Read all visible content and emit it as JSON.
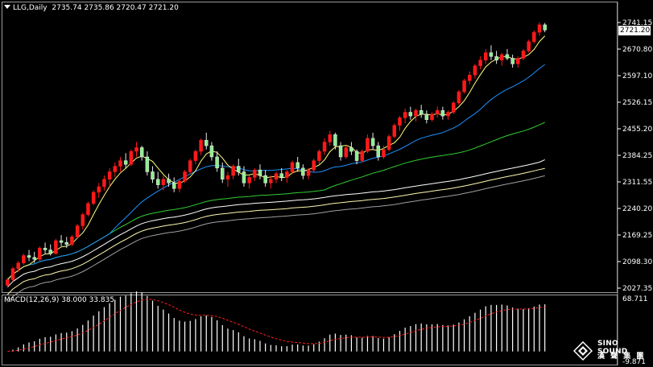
{
  "header": {
    "symbol": "LLG,Daily",
    "ohlc": "2735.74 2735.86 2720.47 2721.20",
    "indicator": "MACD(12,26,9) 38.000 33.835"
  },
  "price_axis": {
    "ticks": [
      "2741.15",
      "2670.80",
      "2597.10",
      "2526.15",
      "2455.20",
      "2384.25",
      "2311.55",
      "2240.20",
      "2169.25",
      "2098.30",
      "2027.35"
    ],
    "current": "2721.20"
  },
  "macd_axis": {
    "top": "68.711",
    "bottom": "-9.871"
  },
  "watermark": {
    "brand": "SINO SOUND",
    "sub": "漢 聲 集 團"
  },
  "colors": {
    "bull": "#ff1a1a",
    "bear": "#e8e8e8",
    "bear_fill": "#90ee90",
    "ma5": "#ffff80",
    "ma20": "#1e90ff",
    "ma60": "#32cd32",
    "ma100": "#ffffff",
    "ma200": "#fff8b0",
    "ma300": "#a0a0a0",
    "macd_hist": "#ffffff",
    "macd_signal": "#ff2020"
  },
  "chart_data": {
    "type": "candlestick",
    "timeframe": "Daily",
    "ylim": [
      2027.35,
      2741.15
    ],
    "candles": [
      [
        2035,
        2055,
        2030,
        2050
      ],
      [
        2050,
        2085,
        2045,
        2080
      ],
      [
        2080,
        2100,
        2070,
        2095
      ],
      [
        2095,
        2120,
        2090,
        2115
      ],
      [
        2115,
        2130,
        2100,
        2110
      ],
      [
        2110,
        2125,
        2095,
        2105
      ],
      [
        2105,
        2140,
        2100,
        2135
      ],
      [
        2135,
        2150,
        2120,
        2130
      ],
      [
        2130,
        2145,
        2115,
        2120
      ],
      [
        2120,
        2160,
        2118,
        2155
      ],
      [
        2155,
        2170,
        2140,
        2150
      ],
      [
        2150,
        2165,
        2135,
        2145
      ],
      [
        2145,
        2170,
        2140,
        2165
      ],
      [
        2165,
        2200,
        2160,
        2195
      ],
      [
        2195,
        2230,
        2185,
        2225
      ],
      [
        2225,
        2260,
        2220,
        2255
      ],
      [
        2255,
        2290,
        2250,
        2285
      ],
      [
        2285,
        2310,
        2270,
        2300
      ],
      [
        2300,
        2330,
        2290,
        2320
      ],
      [
        2320,
        2350,
        2300,
        2340
      ],
      [
        2340,
        2365,
        2325,
        2355
      ],
      [
        2355,
        2380,
        2340,
        2370
      ],
      [
        2370,
        2390,
        2350,
        2360
      ],
      [
        2360,
        2400,
        2355,
        2395
      ],
      [
        2395,
        2420,
        2380,
        2405
      ],
      [
        2405,
        2410,
        2370,
        2380
      ],
      [
        2380,
        2395,
        2330,
        2340
      ],
      [
        2340,
        2355,
        2310,
        2320
      ],
      [
        2320,
        2340,
        2295,
        2305
      ],
      [
        2305,
        2330,
        2290,
        2320
      ],
      [
        2320,
        2335,
        2300,
        2310
      ],
      [
        2310,
        2325,
        2285,
        2295
      ],
      [
        2295,
        2320,
        2285,
        2315
      ],
      [
        2315,
        2345,
        2310,
        2340
      ],
      [
        2340,
        2375,
        2335,
        2370
      ],
      [
        2370,
        2400,
        2360,
        2395
      ],
      [
        2395,
        2430,
        2385,
        2425
      ],
      [
        2425,
        2445,
        2400,
        2410
      ],
      [
        2410,
        2420,
        2370,
        2380
      ],
      [
        2380,
        2395,
        2340,
        2350
      ],
      [
        2350,
        2365,
        2310,
        2320
      ],
      [
        2320,
        2340,
        2300,
        2330
      ],
      [
        2330,
        2360,
        2320,
        2355
      ],
      [
        2355,
        2375,
        2330,
        2340
      ],
      [
        2340,
        2355,
        2300,
        2310
      ],
      [
        2310,
        2330,
        2295,
        2325
      ],
      [
        2325,
        2350,
        2315,
        2345
      ],
      [
        2345,
        2360,
        2320,
        2330
      ],
      [
        2330,
        2345,
        2300,
        2310
      ],
      [
        2310,
        2330,
        2295,
        2320
      ],
      [
        2320,
        2340,
        2310,
        2335
      ],
      [
        2335,
        2350,
        2315,
        2325
      ],
      [
        2325,
        2345,
        2310,
        2340
      ],
      [
        2340,
        2370,
        2335,
        2365
      ],
      [
        2365,
        2380,
        2340,
        2350
      ],
      [
        2350,
        2360,
        2320,
        2330
      ],
      [
        2330,
        2350,
        2320,
        2345
      ],
      [
        2345,
        2375,
        2340,
        2370
      ],
      [
        2370,
        2400,
        2360,
        2395
      ],
      [
        2395,
        2430,
        2385,
        2420
      ],
      [
        2420,
        2450,
        2410,
        2440
      ],
      [
        2440,
        2445,
        2400,
        2410
      ],
      [
        2410,
        2420,
        2370,
        2380
      ],
      [
        2380,
        2410,
        2375,
        2405
      ],
      [
        2405,
        2420,
        2385,
        2395
      ],
      [
        2395,
        2400,
        2360,
        2370
      ],
      [
        2370,
        2400,
        2365,
        2395
      ],
      [
        2395,
        2440,
        2390,
        2430
      ],
      [
        2430,
        2445,
        2400,
        2410
      ],
      [
        2410,
        2420,
        2370,
        2380
      ],
      [
        2380,
        2410,
        2375,
        2400
      ],
      [
        2400,
        2440,
        2395,
        2435
      ],
      [
        2435,
        2470,
        2430,
        2465
      ],
      [
        2465,
        2490,
        2450,
        2485
      ],
      [
        2485,
        2510,
        2470,
        2500
      ],
      [
        2500,
        2515,
        2480,
        2490
      ],
      [
        2490,
        2510,
        2475,
        2505
      ],
      [
        2505,
        2520,
        2485,
        2495
      ],
      [
        2495,
        2505,
        2470,
        2480
      ],
      [
        2480,
        2500,
        2475,
        2495
      ],
      [
        2495,
        2515,
        2485,
        2505
      ],
      [
        2505,
        2515,
        2480,
        2490
      ],
      [
        2490,
        2505,
        2480,
        2500
      ],
      [
        2500,
        2530,
        2495,
        2525
      ],
      [
        2525,
        2560,
        2520,
        2555
      ],
      [
        2555,
        2590,
        2550,
        2585
      ],
      [
        2585,
        2610,
        2575,
        2600
      ],
      [
        2600,
        2630,
        2590,
        2625
      ],
      [
        2625,
        2650,
        2615,
        2640
      ],
      [
        2640,
        2670,
        2630,
        2660
      ],
      [
        2660,
        2680,
        2640,
        2650
      ],
      [
        2650,
        2665,
        2630,
        2640
      ],
      [
        2640,
        2660,
        2625,
        2655
      ],
      [
        2655,
        2670,
        2640,
        2645
      ],
      [
        2645,
        2655,
        2620,
        2630
      ],
      [
        2630,
        2650,
        2620,
        2645
      ],
      [
        2645,
        2670,
        2640,
        2665
      ],
      [
        2665,
        2695,
        2660,
        2690
      ],
      [
        2690,
        2720,
        2685,
        2715
      ],
      [
        2715,
        2742,
        2705,
        2735
      ],
      [
        2735,
        2740,
        2715,
        2721
      ]
    ]
  }
}
